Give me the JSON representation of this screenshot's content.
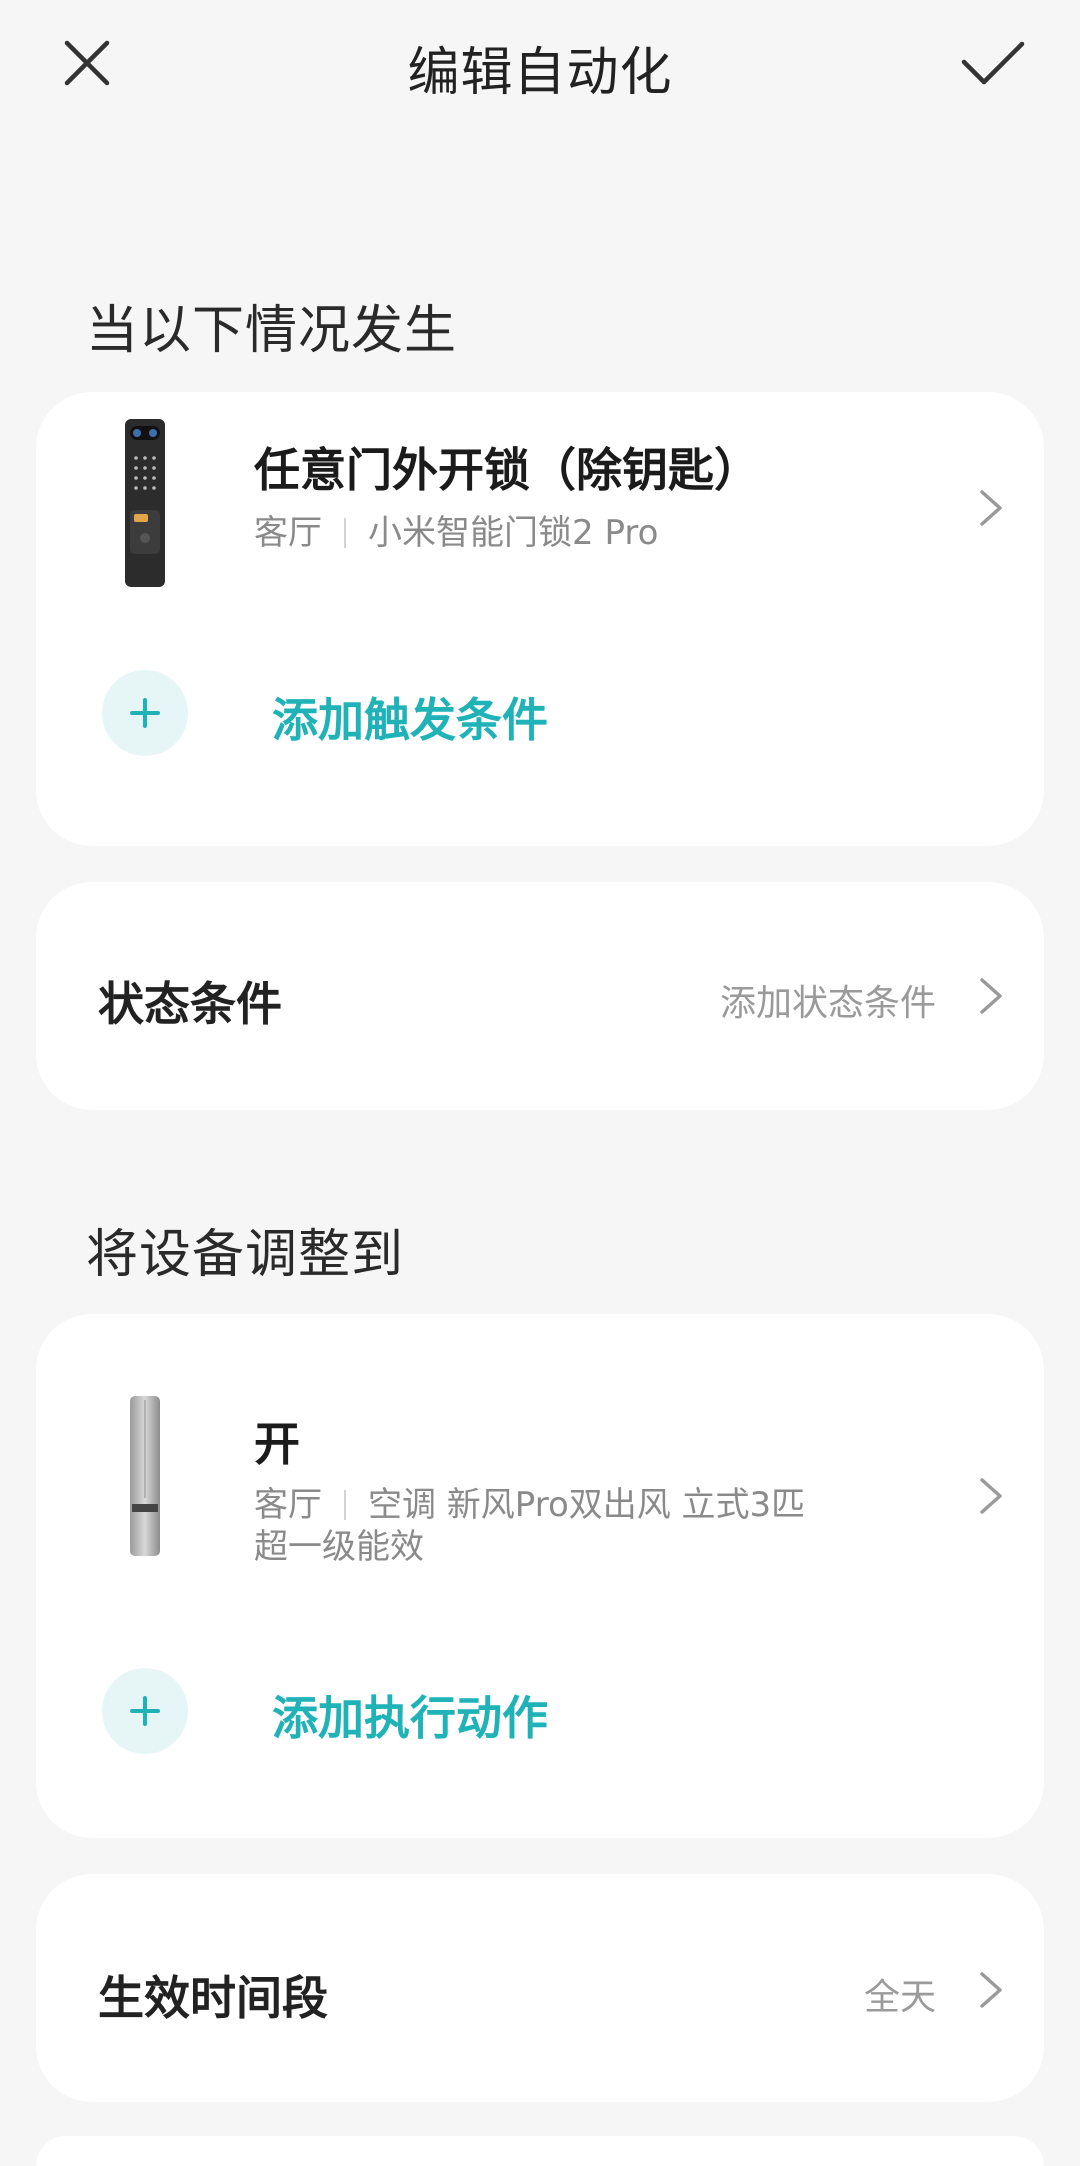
{
  "header": {
    "title": "编辑自动化",
    "close_icon": "close-icon",
    "confirm_icon": "check-icon"
  },
  "trigger_section": {
    "title": "当以下情况发生",
    "trigger": {
      "title": "任意门外开锁（除钥匙）",
      "room": "客厅",
      "device": "小米智能门锁2 Pro",
      "device_icon": "door-lock-image"
    },
    "add_label": "添加触发条件"
  },
  "state_condition": {
    "label": "状态条件",
    "value": "添加状态条件"
  },
  "action_section": {
    "title": "将设备调整到",
    "action": {
      "title": "开",
      "room": "客厅",
      "device_line1": "空调 新风Pro双出风 立式3匹",
      "device_line2": "超一级能效",
      "device_icon": "air-conditioner-image"
    },
    "add_label": "添加执行动作"
  },
  "time_period": {
    "label": "生效时间段",
    "value": "全天"
  },
  "colors": {
    "accent": "#1fb3b8",
    "background": "#f6f6f6",
    "card": "#ffffff"
  }
}
